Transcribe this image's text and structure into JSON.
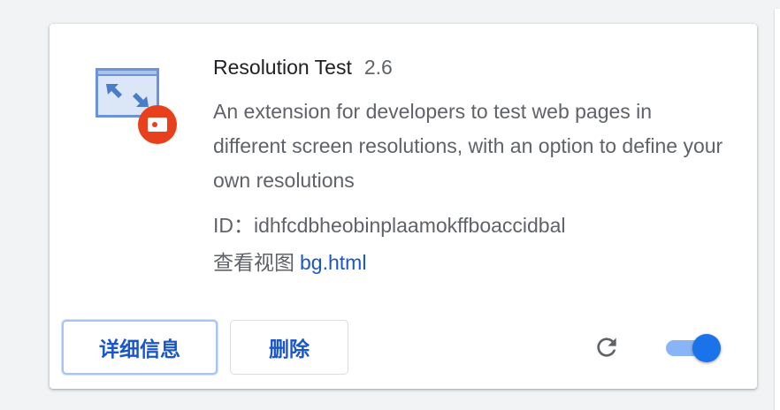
{
  "extension": {
    "name": "Resolution Test",
    "version": "2.6",
    "description": "An extension for developers to test web pages in different screen resolutions, with an option to define your own resolutions",
    "id_line": "ID：idhfcdbheobinplaamokffboaccidbal",
    "inspect_label": "查看视图",
    "inspect_link": "bg.html",
    "icon": "resolution-test-icon",
    "enabled": true
  },
  "actions": {
    "details_label": "详细信息",
    "remove_label": "删除",
    "reload_icon": "reload-icon"
  },
  "colors": {
    "accent": "#1a73e8",
    "link": "#1a56c9",
    "toggle_track": "#8ab4f8",
    "icon_badge": "#e8401c"
  }
}
